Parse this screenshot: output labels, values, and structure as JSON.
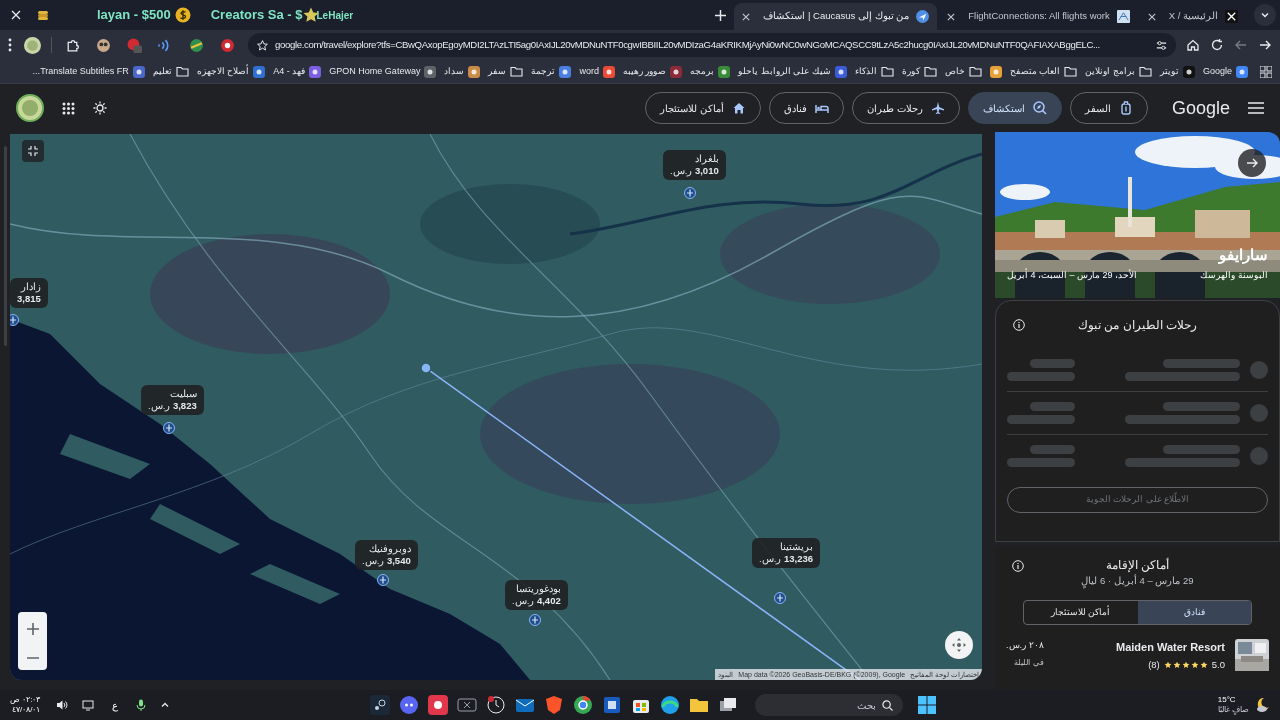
{
  "stream_overlay": [
    "LeHajer",
    "Creators Sa - $",
    "layan - $500"
  ],
  "browser": {
    "tabs": [
      {
        "title": "الرئيسية / X",
        "selected": false
      },
      {
        "title": "FlightConnections: All flights work",
        "selected": false
      },
      {
        "title": "من تبوك إلى Caucasus | استكشاف",
        "selected": true
      }
    ],
    "url": "google.com/travel/explore?tfs=CBwQAxopEgoyMDI2LTAzLTI5ag0IAxIJL20vMDNuNTF0cgwIBBIIL20vMDIzaG4aKRIKMjAyNi0wNC0wNGoMCAQSCC9tLzA5c2hucg0IAxIJL20vMDNuNTF0QAFIAXABggELC...",
    "bookmarks": [
      {
        "kind": "site",
        "label": "Google"
      },
      {
        "kind": "site",
        "label": "تويتر"
      },
      {
        "kind": "folder",
        "label": "برامج اونلاين"
      },
      {
        "kind": "folder",
        "label": "العاب متصفح"
      },
      {
        "kind": "site"
      },
      {
        "kind": "folder",
        "label": "خاص"
      },
      {
        "kind": "folder",
        "label": "كورة"
      },
      {
        "kind": "folder",
        "label": "الذكاء"
      },
      {
        "kind": "site",
        "label": "شيك على الروابط ياحلو"
      },
      {
        "kind": "site",
        "label": "برمجه"
      },
      {
        "kind": "site",
        "label": "صوور رهيبه"
      },
      {
        "kind": "site",
        "label": "word"
      },
      {
        "kind": "site",
        "label": "ترجمة"
      },
      {
        "kind": "folder",
        "label": "سفر"
      },
      {
        "kind": "site",
        "label": "سداد"
      },
      {
        "kind": "site",
        "label": "GPON Home Gateway"
      },
      {
        "kind": "site",
        "label": "فهد - A4"
      },
      {
        "kind": "site",
        "label": "أصلاح الاجهزه"
      },
      {
        "kind": "folder",
        "label": "تعليم"
      },
      {
        "kind": "site",
        "label": "Translate Subtitles FR..."
      }
    ]
  },
  "header": {
    "logo": "Google",
    "nav": [
      {
        "label": "السفر",
        "selected": false
      },
      {
        "label": "استكشاف",
        "selected": true
      },
      {
        "label": "رحلات طيران",
        "selected": false
      },
      {
        "label": "فنادق",
        "selected": false
      },
      {
        "label": "أماكن للاستئجار",
        "selected": false
      }
    ]
  },
  "map": {
    "pins": [
      {
        "city": "بلغراد",
        "price": "**3,010** ر.س."
      },
      {
        "city": "زادار",
        "price": "**3,815**"
      },
      {
        "city": "سبليت",
        "price": "**3,823** ر.س."
      },
      {
        "city": "دوبروفنيك",
        "price": "**3,540** ر.س."
      },
      {
        "city": "بودغوريتسا",
        "price": "**4,402** ر.س."
      },
      {
        "city": "بريشتينا",
        "price": "**13,236** ر.س."
      }
    ],
    "attribution": [
      "اختصارات لوحة المفاتيح",
      "Map data ©2026 GeoBasis-DE/BKG (©2009), Google",
      "البنود"
    ]
  },
  "destination": {
    "title": "سارايفو",
    "country": "البوسنة والهرسك",
    "dates": "الأحد، 29 مارس – السبت، 4 أبريل"
  },
  "flights": {
    "title": "رحلات الطيران من تبوك",
    "loading": true,
    "button": {
      "label": "الاطّلاع على الرحلات الجوية",
      "disabled": true
    }
  },
  "stays": {
    "title": "أماكن الإقامة",
    "dates": "29 مارس – 4 أبريل · 6 ليالٍ",
    "tabs": [
      {
        "label": "فنادق",
        "selected": true
      },
      {
        "label": "أماكن للاستئجار",
        "selected": false
      }
    ],
    "hotels": [
      {
        "name": "Maiden Water Resort",
        "rating": "5.0",
        "stars": 5,
        "reviews": "(8)",
        "price": "٢٠٨ ر.س.",
        "per_night": "في الليلة"
      }
    ]
  },
  "taskbar": {
    "time": "٠٢:٠٣ ص",
    "date": "٤٧/٠٨/٠١",
    "language": "ع",
    "search_placeholder": "بحث",
    "temperature": "15°C",
    "condition": "صافٍ غالبًا"
  }
}
